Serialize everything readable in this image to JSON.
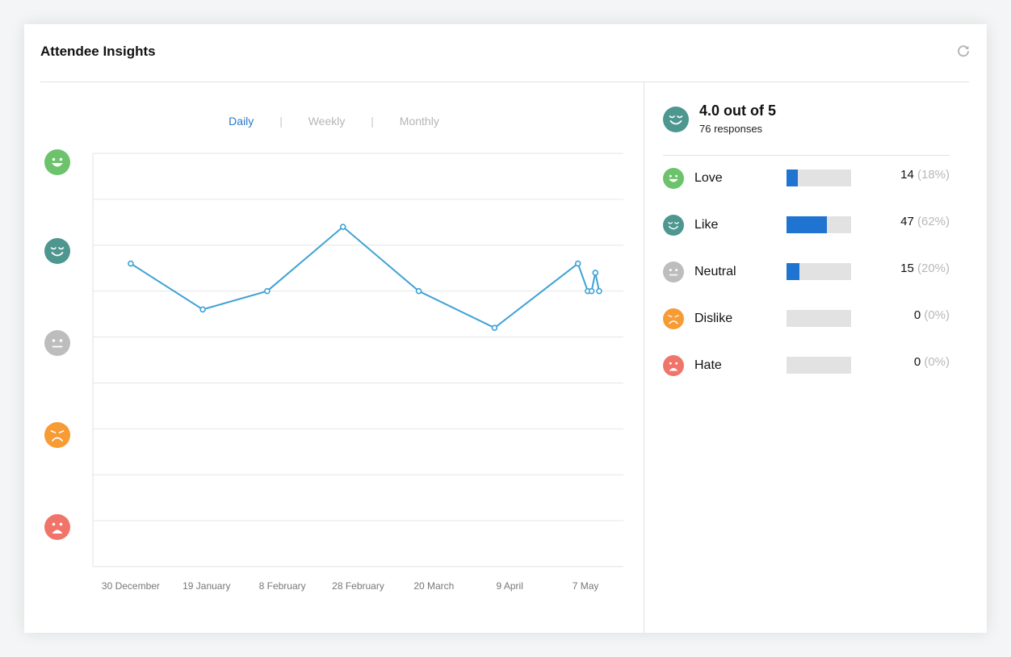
{
  "title": "Attendee Insights",
  "icons": {
    "refresh": "refresh-icon",
    "love": "grinning-face-icon",
    "like": "smiling-face-icon",
    "neutral": "neutral-face-icon",
    "dislike": "frowning-face-icon",
    "hate": "crying-face-icon"
  },
  "colors": {
    "love": "#6cc36c",
    "like": "#4e9690",
    "neutral": "#bdbdbd",
    "dislike": "#f79b35",
    "hate": "#f0746a",
    "line": "#3ea2d6",
    "bar_fill": "#1f74d1",
    "bar_track": "#e2e2e2",
    "tab_active": "#2a78c8"
  },
  "tabs": [
    {
      "label": "Daily",
      "active": true
    },
    {
      "label": "Weekly",
      "active": false
    },
    {
      "label": "Monthly",
      "active": false
    }
  ],
  "tab_separator": "|",
  "summary": {
    "score": "4.0 out of 5",
    "responses": "76 responses"
  },
  "breakdown": [
    {
      "label": "Love",
      "count": "14",
      "percent": "(18%)",
      "fraction": 0.18
    },
    {
      "label": "Like",
      "count": "47",
      "percent": "(62%)",
      "fraction": 0.62
    },
    {
      "label": "Neutral",
      "count": "15",
      "percent": "(20%)",
      "fraction": 0.2
    },
    {
      "label": "Dislike",
      "count": "0",
      "percent": "(0%)",
      "fraction": 0
    },
    {
      "label": "Hate",
      "count": "0",
      "percent": "(0%)",
      "fraction": 0
    }
  ],
  "chart_data": {
    "type": "line",
    "x_tick_labels": [
      "30 December",
      "19 January",
      "8 February",
      "28 February",
      "20 March",
      "9 April",
      "7 May"
    ],
    "y_levels": [
      "Love",
      "Like",
      "Neutral",
      "Dislike",
      "Hate"
    ],
    "ylim": [
      1,
      5.5
    ],
    "grid": true,
    "points": [
      {
        "x": 0.5,
        "y": 4.3
      },
      {
        "x": 1.45,
        "y": 3.8
      },
      {
        "x": 2.3,
        "y": 4.0
      },
      {
        "x": 3.3,
        "y": 4.7
      },
      {
        "x": 4.3,
        "y": 4.0
      },
      {
        "x": 5.3,
        "y": 3.6
      },
      {
        "x": 6.4,
        "y": 4.3
      },
      {
        "x": 6.53,
        "y": 4.0
      },
      {
        "x": 6.58,
        "y": 4.0
      },
      {
        "x": 6.63,
        "y": 4.2
      },
      {
        "x": 6.68,
        "y": 4.0
      }
    ]
  }
}
